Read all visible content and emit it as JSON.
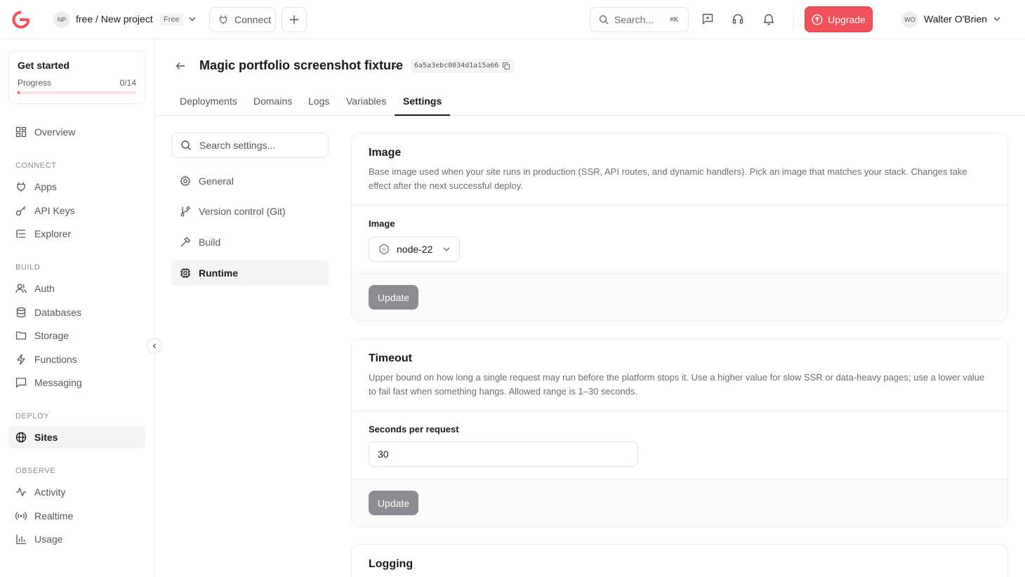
{
  "topbar": {
    "project_initials": "NP",
    "project_name": "free / New project",
    "plan_badge": "Free",
    "connect_label": "Connect",
    "search_placeholder": "Search...",
    "search_shortcut": "⌘K",
    "upgrade_label": "Upgrade",
    "user_initials": "WO",
    "user_name": "Walter O'Brien",
    "icons": [
      "feedback-icon",
      "support-headset-icon",
      "bell-icon"
    ]
  },
  "sidebar": {
    "get_started": {
      "title": "Get started",
      "progress_label": "Progress",
      "progress_count": "0/14",
      "progress_fraction": 0.02
    },
    "top_item": {
      "label": "Overview",
      "icon": "overview-icon"
    },
    "sections": [
      {
        "title": "CONNECT",
        "items": [
          {
            "label": "Apps",
            "icon": "plug-icon"
          },
          {
            "label": "API Keys",
            "icon": "key-icon"
          },
          {
            "label": "Explorer",
            "icon": "list-tree-icon"
          }
        ]
      },
      {
        "title": "BUILD",
        "items": [
          {
            "label": "Auth",
            "icon": "users-icon"
          },
          {
            "label": "Databases",
            "icon": "database-icon"
          },
          {
            "label": "Storage",
            "icon": "folder-icon"
          },
          {
            "label": "Functions",
            "icon": "bolt-icon"
          },
          {
            "label": "Messaging",
            "icon": "message-icon"
          }
        ]
      },
      {
        "title": "DEPLOY",
        "items": [
          {
            "label": "Sites",
            "icon": "globe-icon",
            "active": true
          }
        ]
      },
      {
        "title": "OBSERVE",
        "items": [
          {
            "label": "Activity",
            "icon": "activity-icon"
          },
          {
            "label": "Realtime",
            "icon": "broadcast-icon"
          },
          {
            "label": "Usage",
            "icon": "chart-icon"
          }
        ]
      }
    ]
  },
  "header": {
    "site_title": "Magic portfolio screenshot fixture",
    "site_id": "6a5a3ebc0034d1a15a66",
    "tabs": [
      "Deployments",
      "Domains",
      "Logs",
      "Variables",
      "Settings"
    ],
    "active_tab": "Settings"
  },
  "settings_nav": {
    "search_placeholder": "Search settings...",
    "items": [
      {
        "label": "General",
        "icon": "gear-icon"
      },
      {
        "label": "Version control (Git)",
        "icon": "git-branch-icon"
      },
      {
        "label": "Build",
        "icon": "hammer-icon"
      },
      {
        "label": "Runtime",
        "icon": "cpu-icon",
        "active": true
      }
    ]
  },
  "cards": {
    "image": {
      "title": "Image",
      "description": "Base image used when your site runs in production (SSR, API routes, and dynamic handlers). Pick an image that matches your stack. Changes take effect after the next successful deploy.",
      "field_label": "Image",
      "selected_value": "node-22",
      "button_label": "Update"
    },
    "timeout": {
      "title": "Timeout",
      "description": "Upper bound on how long a single request may run before the platform stops it. Use a higher value for slow SSR or data-heavy pages; use a lower value to fail fast when something hangs. Allowed range is 1–30 seconds.",
      "field_label": "Seconds per request",
      "value": "30",
      "button_label": "Update"
    },
    "logging": {
      "title": "Logging"
    }
  },
  "colors": {
    "accent": "#f0525b",
    "text_primary": "#19191c",
    "text_secondary": "#56565c",
    "border": "#ededf0",
    "disabled_button": "#8b8b91"
  }
}
